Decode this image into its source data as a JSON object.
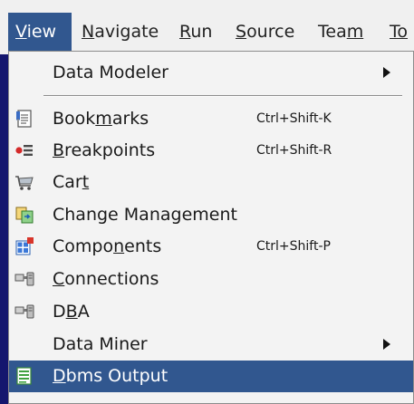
{
  "menubar": {
    "items": [
      {
        "pre": "",
        "key": "V",
        "post": "iew"
      },
      {
        "pre": "",
        "key": "N",
        "post": "avigate"
      },
      {
        "pre": "",
        "key": "R",
        "post": "un"
      },
      {
        "pre": "",
        "key": "S",
        "post": "ource"
      },
      {
        "pre": "Tea",
        "key": "m",
        "post": ""
      },
      {
        "pre": "",
        "key": "To",
        "post": ""
      }
    ]
  },
  "menu": {
    "data_modeler": "Data Modeler",
    "bookmarks": {
      "pre": "Book",
      "key": "m",
      "post": "arks",
      "shortcut": "Ctrl+Shift-K"
    },
    "breakpoints": {
      "pre": "",
      "key": "B",
      "post": "reakpoints",
      "shortcut": "Ctrl+Shift-R"
    },
    "cart": {
      "pre": "Car",
      "key": "t",
      "post": ""
    },
    "change_management": "Change Management",
    "components": {
      "pre": "Compo",
      "key": "n",
      "post": "ents",
      "shortcut": "Ctrl+Shift-P"
    },
    "connections": {
      "pre": "",
      "key": "C",
      "post": "onnections"
    },
    "dba": {
      "pre": "D",
      "key": "B",
      "post": "A"
    },
    "data_miner": "Data Miner",
    "dbms_output": {
      "pre": "",
      "key": "D",
      "post": "bms Output"
    }
  },
  "icons": {
    "bookmarks": "bookmarks-icon",
    "breakpoints": "breakpoints-icon",
    "cart": "cart-icon",
    "change_management": "change-management-icon",
    "components": "components-icon",
    "connections": "connections-icon",
    "dba": "dba-icon",
    "dbms_output": "dbms-output-icon"
  },
  "colors": {
    "highlight": "#31578f",
    "backdrop": "#14166e",
    "menu_bg": "#f3f3f3"
  }
}
